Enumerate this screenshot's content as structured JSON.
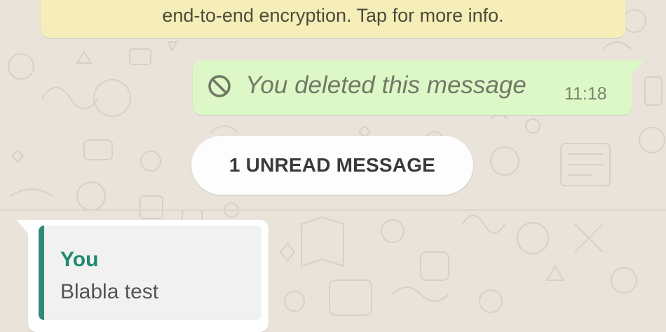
{
  "encryption_banner": {
    "text": "end-to-end encryption. Tap for more info."
  },
  "outgoing_message": {
    "deleted_text": "You deleted this message",
    "time": "11:18",
    "icon": "blocked-icon"
  },
  "unread_divider": {
    "label": "1 UNREAD MESSAGE"
  },
  "incoming_message": {
    "quote_author": "You",
    "quote_text": "Blabla test"
  },
  "colors": {
    "wallpaper": "#e9e3da",
    "banner": "#f6eeb9",
    "outgoing_bubble": "#dcf8c6",
    "incoming_bubble": "#ffffff",
    "quote_accent": "#2e8b78"
  }
}
